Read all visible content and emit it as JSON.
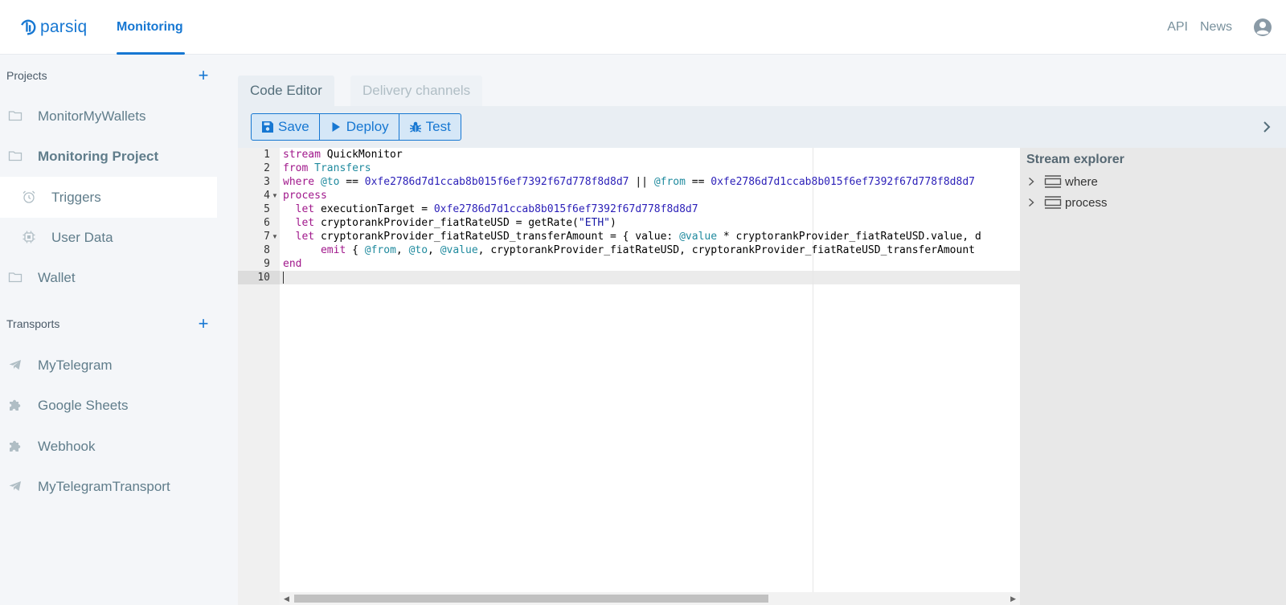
{
  "header": {
    "brand": "parsiq",
    "nav_active": "Monitoring",
    "links": {
      "api": "API",
      "news": "News"
    },
    "accent_color": "#1677d2",
    "user_icon": "user-circle-icon"
  },
  "sidebar": {
    "projects_title": "Projects",
    "projects": [
      {
        "label": "MonitorMyWallets",
        "icon": "folder-icon"
      },
      {
        "label": "Monitoring Project",
        "icon": "folder-icon"
      },
      {
        "label": "Triggers",
        "icon": "alarm-clock-icon"
      },
      {
        "label": "User Data",
        "icon": "chip-icon"
      },
      {
        "label": "Wallet",
        "icon": "folder-icon"
      }
    ],
    "transports_title": "Transports",
    "transports": [
      {
        "label": "MyTelegram",
        "icon": "telegram-icon"
      },
      {
        "label": "Google Sheets",
        "icon": "puzzle-icon"
      },
      {
        "label": "Webhook",
        "icon": "puzzle-icon"
      },
      {
        "label": "MyTelegramTransport",
        "icon": "telegram-icon"
      }
    ]
  },
  "tabs": {
    "code_editor": "Code Editor",
    "delivery_channels": "Delivery channels"
  },
  "toolbar": {
    "save": "Save",
    "deploy": "Deploy",
    "test": "Test"
  },
  "editor": {
    "line_numbers": [
      "1",
      "2",
      "3",
      "4",
      "5",
      "6",
      "7",
      "8",
      "9",
      "10"
    ],
    "lines": [
      [
        {
          "t": "stream",
          "c": "kw"
        },
        {
          "t": " QuickMonitor",
          "c": ""
        }
      ],
      [
        {
          "t": "from",
          "c": "kw"
        },
        {
          "t": " ",
          "c": ""
        },
        {
          "t": "Transfers",
          "c": "id"
        }
      ],
      [
        {
          "t": "where",
          "c": "kw"
        },
        {
          "t": " ",
          "c": ""
        },
        {
          "t": "@to",
          "c": "id"
        },
        {
          "t": " == ",
          "c": ""
        },
        {
          "t": "0xfe2786d7d1ccab8b015f6ef7392f67d778f8d8d7",
          "c": "hex"
        },
        {
          "t": " || ",
          "c": ""
        },
        {
          "t": "@from",
          "c": "id"
        },
        {
          "t": " == ",
          "c": ""
        },
        {
          "t": "0xfe2786d7d1ccab8b015f6ef7392f67d778f8d8d7",
          "c": "hex"
        }
      ],
      [
        {
          "t": "process",
          "c": "kw"
        }
      ],
      [
        {
          "t": "  ",
          "c": ""
        },
        {
          "t": "let",
          "c": "kw"
        },
        {
          "t": " executionTarget = ",
          "c": ""
        },
        {
          "t": "0xfe2786d7d1ccab8b015f6ef7392f67d778f8d8d7",
          "c": "hex"
        }
      ],
      [
        {
          "t": "  ",
          "c": ""
        },
        {
          "t": "let",
          "c": "kw"
        },
        {
          "t": " cryptorankProvider_fiatRateUSD = getRate(",
          "c": ""
        },
        {
          "t": "\"ETH\"",
          "c": "str"
        },
        {
          "t": ")",
          "c": ""
        }
      ],
      [
        {
          "t": "  ",
          "c": ""
        },
        {
          "t": "let",
          "c": "kw"
        },
        {
          "t": " cryptorankProvider_fiatRateUSD_transferAmount = { value: ",
          "c": ""
        },
        {
          "t": "@value",
          "c": "id"
        },
        {
          "t": " * cryptorankProvider_fiatRateUSD.value, d",
          "c": ""
        }
      ],
      [
        {
          "t": "      ",
          "c": ""
        },
        {
          "t": "emit",
          "c": "kw"
        },
        {
          "t": " { ",
          "c": ""
        },
        {
          "t": "@from",
          "c": "id"
        },
        {
          "t": ", ",
          "c": ""
        },
        {
          "t": "@to",
          "c": "id"
        },
        {
          "t": ", ",
          "c": ""
        },
        {
          "t": "@value",
          "c": "id"
        },
        {
          "t": ", cryptorankProvider_fiatRateUSD, cryptorankProvider_fiatRateUSD_transferAmount",
          "c": ""
        }
      ],
      [
        {
          "t": "end",
          "c": "kw"
        }
      ],
      [
        {
          "t": "",
          "c": ""
        }
      ]
    ]
  },
  "explorer": {
    "title": "Stream explorer",
    "items": [
      "where",
      "process"
    ]
  }
}
